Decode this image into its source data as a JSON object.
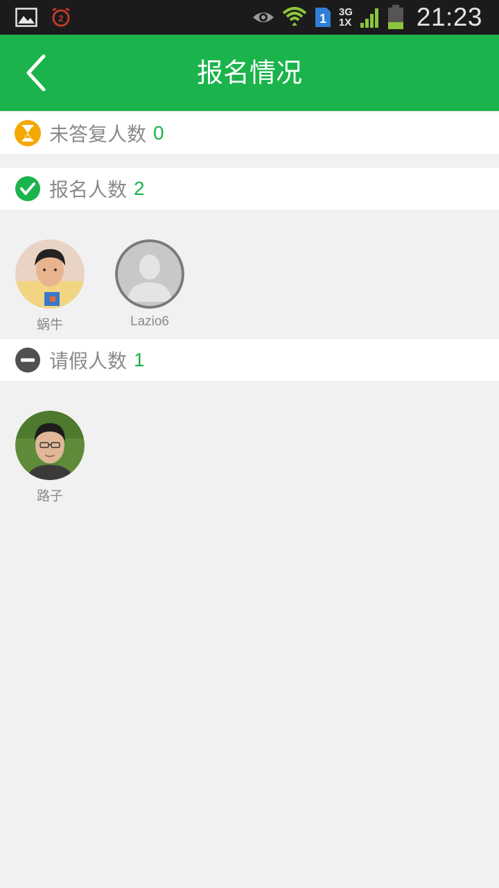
{
  "status_bar": {
    "time": "21:23",
    "network_top": "3G",
    "network_bottom": "1X",
    "sim_label": "1",
    "alarm_badge": "2"
  },
  "header": {
    "title": "报名情况",
    "back_icon": "chevron-left-icon"
  },
  "sections": {
    "no_reply": {
      "label": "未答复人数",
      "count": "0",
      "icon": "hourglass-icon",
      "icon_color": "#f5a800"
    },
    "signed_up": {
      "label": "报名人数",
      "count": "2",
      "icon": "check-circle-icon",
      "icon_color": "#1bb34b",
      "members": [
        {
          "name": "蜗牛"
        },
        {
          "name": "Lazio6"
        }
      ]
    },
    "leave": {
      "label": "请假人数",
      "count": "1",
      "icon": "minus-circle-icon",
      "icon_color": "#505050",
      "members": [
        {
          "name": "路子"
        }
      ]
    }
  },
  "colors": {
    "accent": "#1bb34b",
    "background": "#f1f1f1",
    "label_text": "#8a8a8a"
  }
}
